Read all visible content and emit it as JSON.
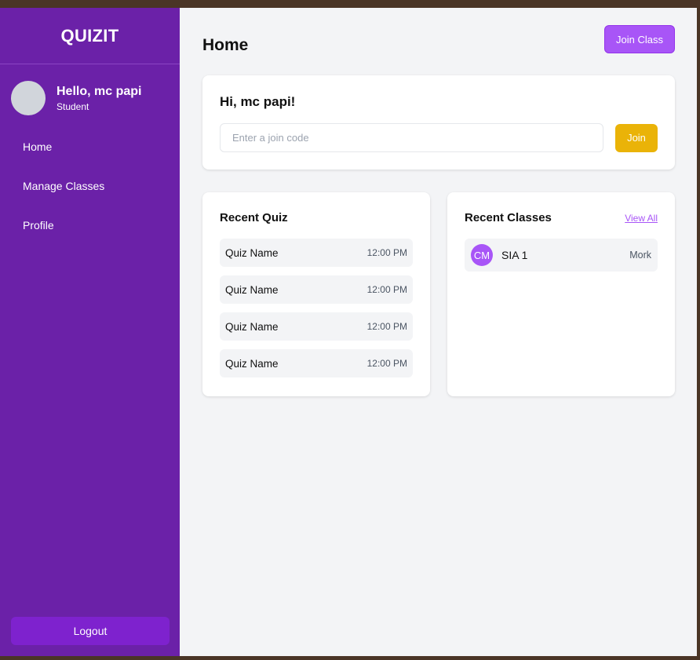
{
  "sidebar": {
    "brand": "QUIZIT",
    "greeting": "Hello, mc papi",
    "role": "Student",
    "items": [
      {
        "label": "Home"
      },
      {
        "label": "Manage Classes"
      },
      {
        "label": "Profile"
      }
    ],
    "logout_label": "Logout"
  },
  "header": {
    "title": "Home",
    "join_class_label": "Join Class"
  },
  "hero": {
    "title": "Hi, mc papi!",
    "join_placeholder": "Enter a join code",
    "join_value": "",
    "join_button": "Join"
  },
  "recent_quiz": {
    "title": "Recent Quiz",
    "items": [
      {
        "name": "Quiz Name",
        "time": "12:00 PM"
      },
      {
        "name": "Quiz Name",
        "time": "12:00 PM"
      },
      {
        "name": "Quiz Name",
        "time": "12:00 PM"
      },
      {
        "name": "Quiz Name",
        "time": "12:00 PM"
      }
    ]
  },
  "recent_classes": {
    "title": "Recent Classes",
    "view_all": "View All",
    "items": [
      {
        "initials": "CM",
        "name": "SIA 1",
        "teacher": "Mork"
      }
    ]
  },
  "colors": {
    "sidebar_bg": "#6b21a8",
    "accent": "#a855f7",
    "join_button": "#eab308",
    "logout_button": "#7e22ce"
  }
}
